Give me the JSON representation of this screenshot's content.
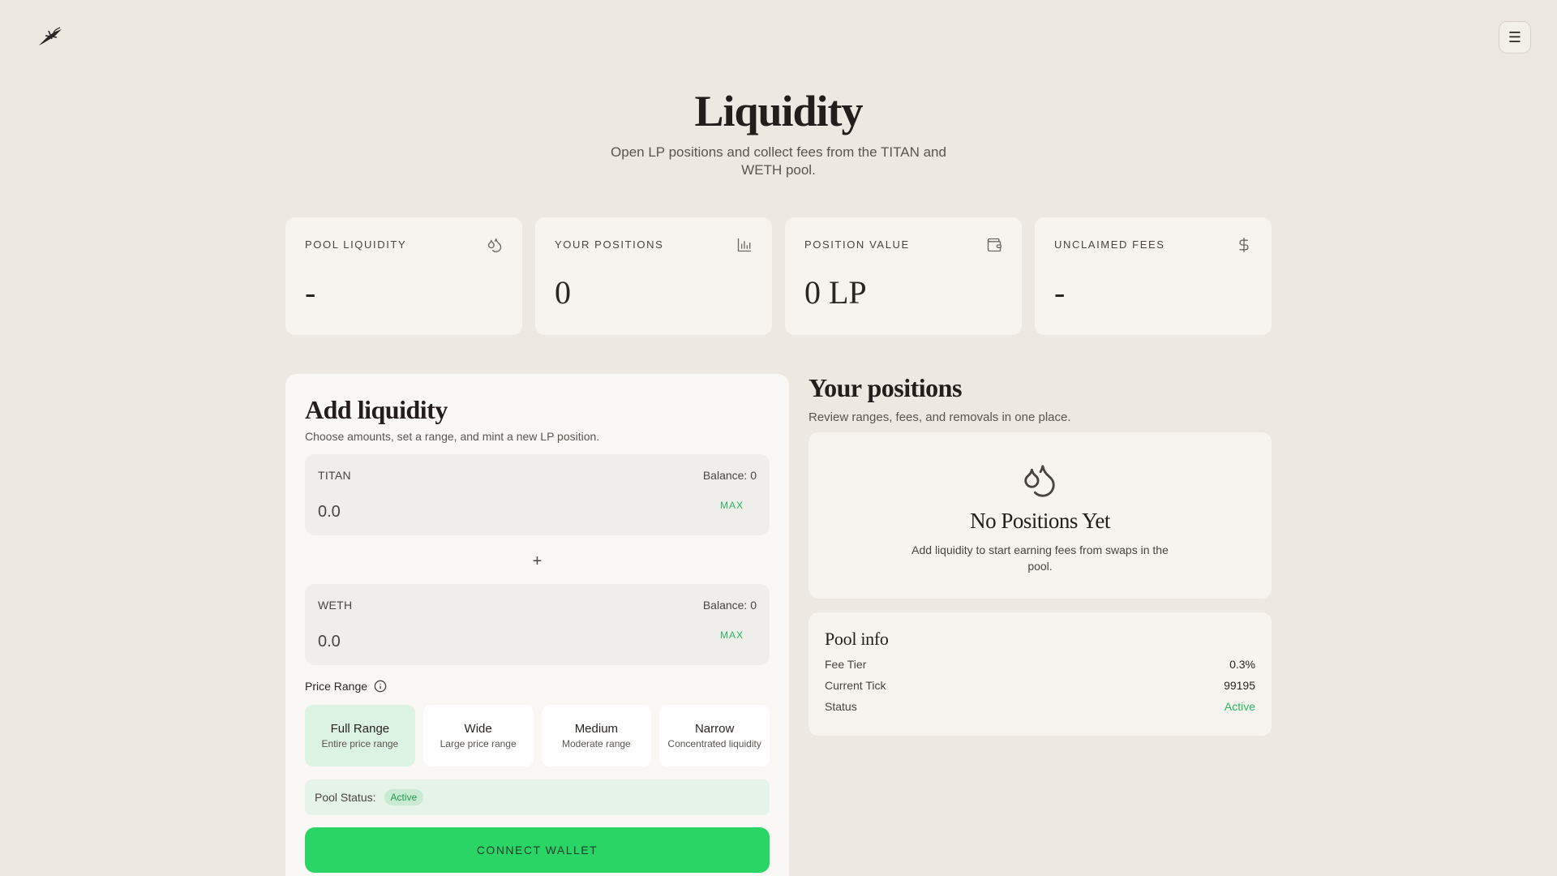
{
  "header": {
    "logo_icon": "bird-logo-icon",
    "menu_icon": "hamburger-menu-icon",
    "menu_glyph": "☰"
  },
  "hero": {
    "title": "Liquidity",
    "subtitle": "Open LP positions and collect fees from the TITAN and WETH pool."
  },
  "stats": [
    {
      "label": "POOL LIQUIDITY",
      "value": "-",
      "icon": "droplets-icon"
    },
    {
      "label": "YOUR POSITIONS",
      "value": "0",
      "icon": "bar-chart-icon"
    },
    {
      "label": "POSITION VALUE",
      "value": "0 LP",
      "icon": "wallet-icon"
    },
    {
      "label": "UNCLAIMED FEES",
      "value": "-",
      "icon": "dollar-icon"
    }
  ],
  "add_liquidity": {
    "title": "Add liquidity",
    "subtitle": "Choose amounts, set a range, and mint a new LP position.",
    "token_a": {
      "name": "TITAN",
      "balance": "Balance: 0",
      "placeholder": "0.0",
      "max_label": "MAX"
    },
    "plus": "+",
    "token_b": {
      "name": "WETH",
      "balance": "Balance: 0",
      "placeholder": "0.0",
      "max_label": "MAX"
    },
    "price_range_label": "Price Range",
    "range_options": [
      {
        "title": "Full Range",
        "desc": "Entire price range"
      },
      {
        "title": "Wide",
        "desc": "Large price range"
      },
      {
        "title": "Medium",
        "desc": "Moderate range"
      },
      {
        "title": "Narrow",
        "desc": "Concentrated liquidity"
      }
    ],
    "pool_status_label": "Pool Status:",
    "pool_status_value": "Active",
    "connect_label": "CONNECT WALLET"
  },
  "positions": {
    "title": "Your positions",
    "subtitle": "Review ranges, fees, and removals in one place.",
    "empty_title": "No Positions Yet",
    "empty_desc": "Add liquidity to start earning fees from swaps in the pool."
  },
  "pool_info": {
    "title": "Pool info",
    "rows": [
      {
        "label": "Fee Tier",
        "value": "0.3%"
      },
      {
        "label": "Current Tick",
        "value": "99195"
      },
      {
        "label": "Status",
        "value": "Active"
      }
    ]
  },
  "colors": {
    "background": "#ede8e1",
    "card": "#f7f4ef",
    "accent_green": "#28d565",
    "status_green": "#28b860"
  }
}
